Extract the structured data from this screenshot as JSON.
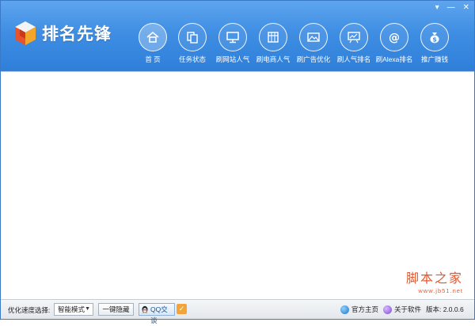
{
  "window": {
    "controls": {
      "menu_glyph": "▾",
      "minimize_glyph": "—",
      "close_glyph": "✕"
    }
  },
  "logo": {
    "brand": "排名先锋",
    "icon": "cube-logo-icon"
  },
  "nav": {
    "items": [
      {
        "label": "首  页",
        "icon": "home-icon",
        "active": true
      },
      {
        "label": "任务状态",
        "icon": "copy-pages-icon"
      },
      {
        "label": "刷网站人气",
        "icon": "monitor-icon"
      },
      {
        "label": "刷电商人气",
        "icon": "store-icon"
      },
      {
        "label": "刷广告优化",
        "icon": "image-ad-icon"
      },
      {
        "label": "刷人气排名",
        "icon": "presentation-chart-icon"
      },
      {
        "label": "刷Alexa排名",
        "icon": "at-sign-icon"
      },
      {
        "label": "推广赚钱",
        "icon": "money-bag-icon"
      }
    ]
  },
  "watermark": {
    "title": "脚本之家",
    "url": "www.jb51.net"
  },
  "statusbar": {
    "speed_label": "优化速度选择:",
    "speed_value": "智能模式",
    "hide_button": "一键隐藏",
    "qq_button": "QQ交谈",
    "checkbox_glyph": "✓",
    "homepage_link": "官方主页",
    "about_link": "关于软件",
    "version": "版本: 2.0.0.6"
  },
  "colors": {
    "header_top": "#5ea5ee",
    "header_bottom": "#2f7fda",
    "watermark": "#e4572e"
  }
}
